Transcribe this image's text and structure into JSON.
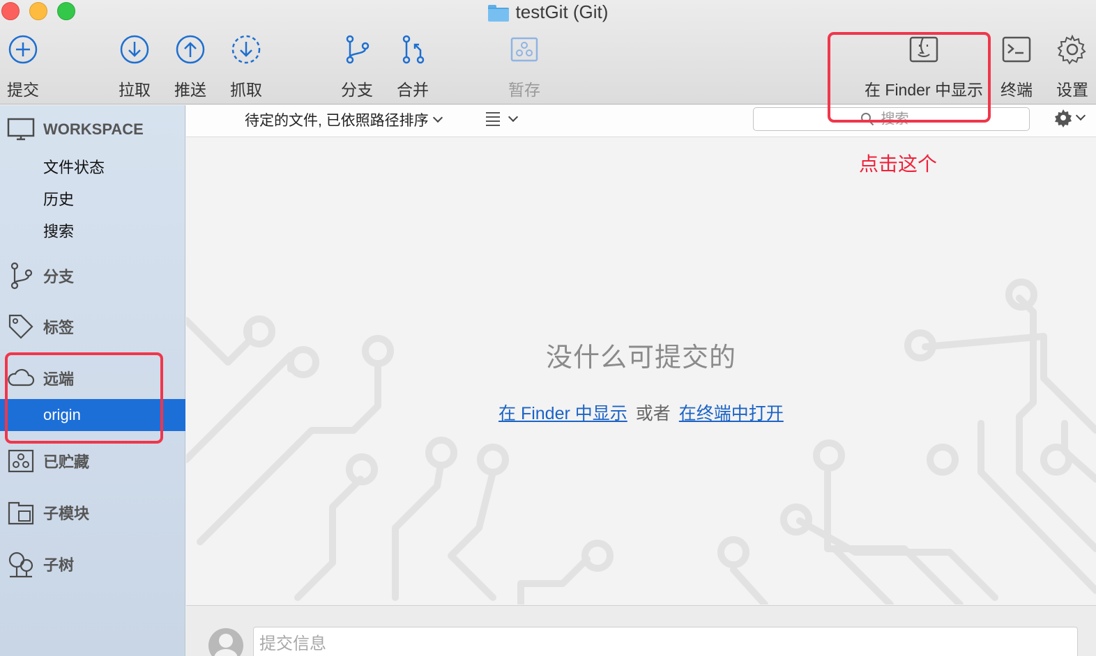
{
  "window": {
    "title": "testGit (Git)"
  },
  "toolbar": {
    "commit": "提交",
    "pull": "拉取",
    "push": "推送",
    "fetch": "抓取",
    "branch": "分支",
    "merge": "合并",
    "stash": "暂存",
    "show_in_finder": "在 Finder 中显示",
    "terminal": "终端",
    "settings": "设置"
  },
  "sidebar": {
    "workspace": "WORKSPACE",
    "workspace_items": [
      "文件状态",
      "历史",
      "搜索"
    ],
    "branches": "分支",
    "tags": "标签",
    "remotes": "远端",
    "remote_selected": "origin",
    "stashes": "已贮藏",
    "submodules": "子模块",
    "subtrees": "子树"
  },
  "filter_bar": {
    "sort_label": "待定的文件, 已依照路径排序",
    "search_placeholder": "搜索"
  },
  "main": {
    "empty_message": "没什么可提交的",
    "link_finder": "在 Finder 中显示",
    "or_text": "或者",
    "link_terminal": "在终端中打开"
  },
  "commit": {
    "placeholder": "提交信息"
  },
  "annotation": {
    "text": "点击这个",
    "color": "#f0223b"
  },
  "colors": {
    "accent": "#1d6fd8",
    "link": "#1b63c6",
    "icon": "#1e6fd0"
  }
}
